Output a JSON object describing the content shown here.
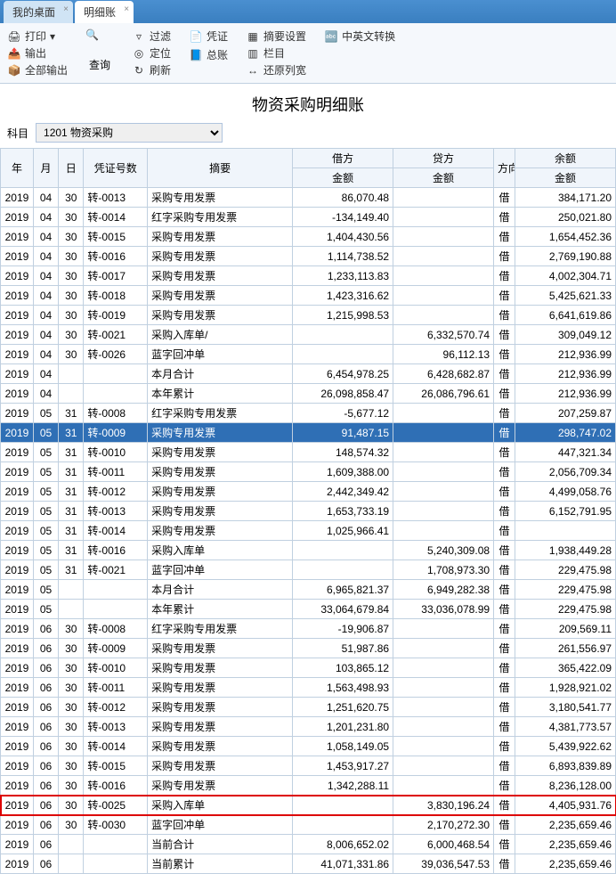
{
  "tabs": [
    {
      "label": "我的桌面",
      "closable": true,
      "active": false
    },
    {
      "label": "明细账",
      "closable": true,
      "active": true
    }
  ],
  "ribbon": {
    "g1": [
      "打印",
      "输出",
      "全部输出"
    ],
    "g1b": {
      "label": "查询"
    },
    "g2": [
      "过滤",
      "定位",
      "刷新"
    ],
    "g3a": {
      "label": "凭证"
    },
    "g3b": {
      "label": "总账"
    },
    "g4": [
      "摘要设置",
      "栏目",
      "还原列宽"
    ],
    "g5": {
      "label": "中英文转换"
    }
  },
  "page_title": "物资采购明细账",
  "filter": {
    "label": "科目",
    "value": "1201 物资采购"
  },
  "headers": {
    "year": "年",
    "month": "月",
    "day": "日",
    "voucher": "凭证号数",
    "summary": "摘要",
    "debit": "借方",
    "credit": "贷方",
    "amount": "金额",
    "dir": "方向",
    "balance": "余额"
  },
  "rows": [
    {
      "y": "2019",
      "m": "04",
      "d": "30",
      "v": "转-0013",
      "s": "采购专用发票",
      "db": "86,070.48",
      "cr": "",
      "dir": "借",
      "bal": "384,171.20"
    },
    {
      "y": "2019",
      "m": "04",
      "d": "30",
      "v": "转-0014",
      "s": "红字采购专用发票",
      "db": "-134,149.40",
      "cr": "",
      "dir": "借",
      "bal": "250,021.80"
    },
    {
      "y": "2019",
      "m": "04",
      "d": "30",
      "v": "转-0015",
      "s": "采购专用发票",
      "db": "1,404,430.56",
      "cr": "",
      "dir": "借",
      "bal": "1,654,452.36"
    },
    {
      "y": "2019",
      "m": "04",
      "d": "30",
      "v": "转-0016",
      "s": "采购专用发票",
      "db": "1,114,738.52",
      "cr": "",
      "dir": "借",
      "bal": "2,769,190.88"
    },
    {
      "y": "2019",
      "m": "04",
      "d": "30",
      "v": "转-0017",
      "s": "采购专用发票",
      "db": "1,233,113.83",
      "cr": "",
      "dir": "借",
      "bal": "4,002,304.71"
    },
    {
      "y": "2019",
      "m": "04",
      "d": "30",
      "v": "转-0018",
      "s": "采购专用发票",
      "db": "1,423,316.62",
      "cr": "",
      "dir": "借",
      "bal": "5,425,621.33"
    },
    {
      "y": "2019",
      "m": "04",
      "d": "30",
      "v": "转-0019",
      "s": "采购专用发票",
      "db": "1,215,998.53",
      "cr": "",
      "dir": "借",
      "bal": "6,641,619.86"
    },
    {
      "y": "2019",
      "m": "04",
      "d": "30",
      "v": "转-0021",
      "s": "采购入库单/",
      "db": "",
      "cr": "6,332,570.74",
      "dir": "借",
      "bal": "309,049.12"
    },
    {
      "y": "2019",
      "m": "04",
      "d": "30",
      "v": "转-0026",
      "s": "蓝字回冲单",
      "db": "",
      "cr": "96,112.13",
      "dir": "借",
      "bal": "212,936.99"
    },
    {
      "y": "2019",
      "m": "04",
      "d": "",
      "v": "",
      "s": "本月合计",
      "db": "6,454,978.25",
      "cr": "6,428,682.87",
      "dir": "借",
      "bal": "212,936.99"
    },
    {
      "y": "2019",
      "m": "04",
      "d": "",
      "v": "",
      "s": "本年累计",
      "db": "26,098,858.47",
      "cr": "26,086,796.61",
      "dir": "借",
      "bal": "212,936.99"
    },
    {
      "y": "2019",
      "m": "05",
      "d": "31",
      "v": "转-0008",
      "s": "红字采购专用发票",
      "db": "-5,677.12",
      "cr": "",
      "dir": "借",
      "bal": "207,259.87"
    },
    {
      "y": "2019",
      "m": "05",
      "d": "31",
      "v": "转-0009",
      "s": "采购专用发票",
      "db": "91,487.15",
      "cr": "",
      "dir": "借",
      "bal": "298,747.02",
      "sel": true
    },
    {
      "y": "2019",
      "m": "05",
      "d": "31",
      "v": "转-0010",
      "s": "采购专用发票",
      "db": "148,574.32",
      "cr": "",
      "dir": "借",
      "bal": "447,321.34"
    },
    {
      "y": "2019",
      "m": "05",
      "d": "31",
      "v": "转-0011",
      "s": "采购专用发票",
      "db": "1,609,388.00",
      "cr": "",
      "dir": "借",
      "bal": "2,056,709.34"
    },
    {
      "y": "2019",
      "m": "05",
      "d": "31",
      "v": "转-0012",
      "s": "采购专用发票",
      "db": "2,442,349.42",
      "cr": "",
      "dir": "借",
      "bal": "4,499,058.76"
    },
    {
      "y": "2019",
      "m": "05",
      "d": "31",
      "v": "转-0013",
      "s": "采购专用发票",
      "db": "1,653,733.19",
      "cr": "",
      "dir": "借",
      "bal": "6,152,791.95"
    },
    {
      "y": "2019",
      "m": "05",
      "d": "31",
      "v": "转-0014",
      "s": "采购专用发票",
      "db": "1,025,966.41",
      "cr": "",
      "dir": "借",
      "bal": ""
    },
    {
      "y": "2019",
      "m": "05",
      "d": "31",
      "v": "转-0016",
      "s": "采购入库单",
      "db": "",
      "cr": "5,240,309.08",
      "dir": "借",
      "bal": "1,938,449.28"
    },
    {
      "y": "2019",
      "m": "05",
      "d": "31",
      "v": "转-0021",
      "s": "蓝字回冲单",
      "db": "",
      "cr": "1,708,973.30",
      "dir": "借",
      "bal": "229,475.98"
    },
    {
      "y": "2019",
      "m": "05",
      "d": "",
      "v": "",
      "s": "本月合计",
      "db": "6,965,821.37",
      "cr": "6,949,282.38",
      "dir": "借",
      "bal": "229,475.98"
    },
    {
      "y": "2019",
      "m": "05",
      "d": "",
      "v": "",
      "s": "本年累计",
      "db": "33,064,679.84",
      "cr": "33,036,078.99",
      "dir": "借",
      "bal": "229,475.98"
    },
    {
      "y": "2019",
      "m": "06",
      "d": "30",
      "v": "转-0008",
      "s": "红字采购专用发票",
      "db": "-19,906.87",
      "cr": "",
      "dir": "借",
      "bal": "209,569.11"
    },
    {
      "y": "2019",
      "m": "06",
      "d": "30",
      "v": "转-0009",
      "s": "采购专用发票",
      "db": "51,987.86",
      "cr": "",
      "dir": "借",
      "bal": "261,556.97"
    },
    {
      "y": "2019",
      "m": "06",
      "d": "30",
      "v": "转-0010",
      "s": "采购专用发票",
      "db": "103,865.12",
      "cr": "",
      "dir": "借",
      "bal": "365,422.09"
    },
    {
      "y": "2019",
      "m": "06",
      "d": "30",
      "v": "转-0011",
      "s": "采购专用发票",
      "db": "1,563,498.93",
      "cr": "",
      "dir": "借",
      "bal": "1,928,921.02"
    },
    {
      "y": "2019",
      "m": "06",
      "d": "30",
      "v": "转-0012",
      "s": "采购专用发票",
      "db": "1,251,620.75",
      "cr": "",
      "dir": "借",
      "bal": "3,180,541.77"
    },
    {
      "y": "2019",
      "m": "06",
      "d": "30",
      "v": "转-0013",
      "s": "采购专用发票",
      "db": "1,201,231.80",
      "cr": "",
      "dir": "借",
      "bal": "4,381,773.57"
    },
    {
      "y": "2019",
      "m": "06",
      "d": "30",
      "v": "转-0014",
      "s": "采购专用发票",
      "db": "1,058,149.05",
      "cr": "",
      "dir": "借",
      "bal": "5,439,922.62"
    },
    {
      "y": "2019",
      "m": "06",
      "d": "30",
      "v": "转-0015",
      "s": "采购专用发票",
      "db": "1,453,917.27",
      "cr": "",
      "dir": "借",
      "bal": "6,893,839.89"
    },
    {
      "y": "2019",
      "m": "06",
      "d": "30",
      "v": "转-0016",
      "s": "采购专用发票",
      "db": "1,342,288.11",
      "cr": "",
      "dir": "借",
      "bal": "8,236,128.00"
    },
    {
      "y": "2019",
      "m": "06",
      "d": "30",
      "v": "转-0025",
      "s": "采购入库单",
      "db": "",
      "cr": "3,830,196.24",
      "dir": "借",
      "bal": "4,405,931.76",
      "red": true
    },
    {
      "y": "2019",
      "m": "06",
      "d": "30",
      "v": "转-0030",
      "s": "蓝字回冲单",
      "db": "",
      "cr": "2,170,272.30",
      "dir": "借",
      "bal": "2,235,659.46"
    },
    {
      "y": "2019",
      "m": "06",
      "d": "",
      "v": "",
      "s": "当前合计",
      "db": "8,006,652.02",
      "cr": "6,000,468.54",
      "dir": "借",
      "bal": "2,235,659.46"
    },
    {
      "y": "2019",
      "m": "06",
      "d": "",
      "v": "",
      "s": "当前累计",
      "db": "41,071,331.86",
      "cr": "39,036,547.53",
      "dir": "借",
      "bal": "2,235,659.46"
    }
  ]
}
